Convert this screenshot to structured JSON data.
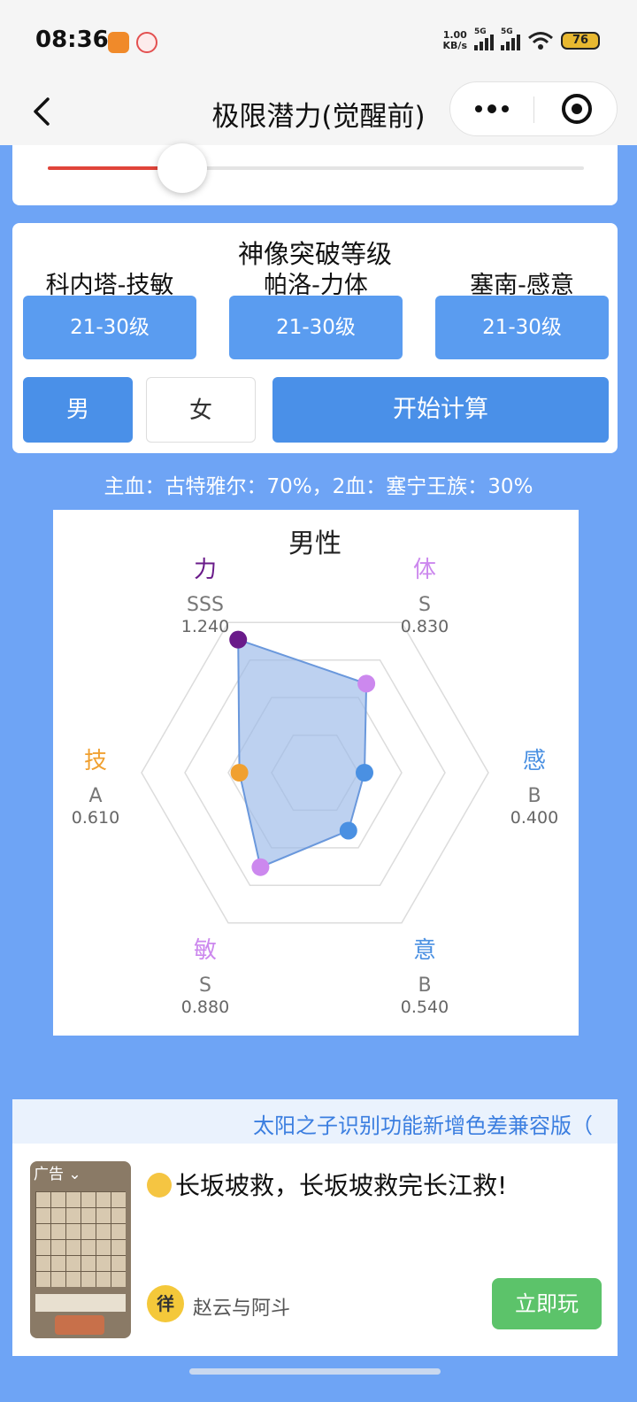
{
  "status_bar": {
    "time": "08:36",
    "net_speed_value": "1.00",
    "net_speed_unit": "KB/s",
    "signal1_label": "5G",
    "signal2_label": "5G",
    "battery": "76"
  },
  "nav": {
    "title": "极限潜力(觉醒前)"
  },
  "slider": {
    "value_fraction": 0.25,
    "fill_color": "#e0443a"
  },
  "settings": {
    "title": "神像突破等级",
    "columns": [
      {
        "label": "科内塔-技敏",
        "value": "21-30级"
      },
      {
        "label": "帕洛-力体",
        "value": "21-30级"
      },
      {
        "label": "塞南-感意",
        "value": "21-30级"
      }
    ],
    "gender_male": "男",
    "gender_female": "女",
    "selected_gender": "male",
    "calc_button": "开始计算"
  },
  "bloodline_text": "主血：古特雅尔：70%，2血：塞宁王族：30%",
  "chart_data": {
    "type": "radar",
    "title": "男性",
    "max": 1.4,
    "rings": 4,
    "axes": [
      {
        "name": "力",
        "grade": "SSS",
        "value": 1.24,
        "display": "1.240",
        "color": "#6a1b8a"
      },
      {
        "name": "体",
        "grade": "S",
        "value": 0.83,
        "display": "0.830",
        "color": "#cc88ee"
      },
      {
        "name": "感",
        "grade": "B",
        "value": 0.4,
        "display": "0.400",
        "color": "#4a90e2"
      },
      {
        "name": "意",
        "grade": "B",
        "value": 0.54,
        "display": "0.540",
        "color": "#4a90e2"
      },
      {
        "name": "敏",
        "grade": "S",
        "value": 0.88,
        "display": "0.880",
        "color": "#cc88ee"
      },
      {
        "name": "技",
        "grade": "A",
        "value": 0.61,
        "display": "0.610",
        "color": "#f0a030"
      }
    ],
    "fill_color": "#9ab9e8",
    "line_color": "#6a98dc"
  },
  "ad": {
    "banner_text": "太阳之子识别功能新增色差兼容版（",
    "thumb_tag": "广告",
    "text": "长坂坡救，长坂坡救完长江救!",
    "avatar_text": "徉",
    "name": "赵云与阿斗",
    "button": "立即玩"
  }
}
